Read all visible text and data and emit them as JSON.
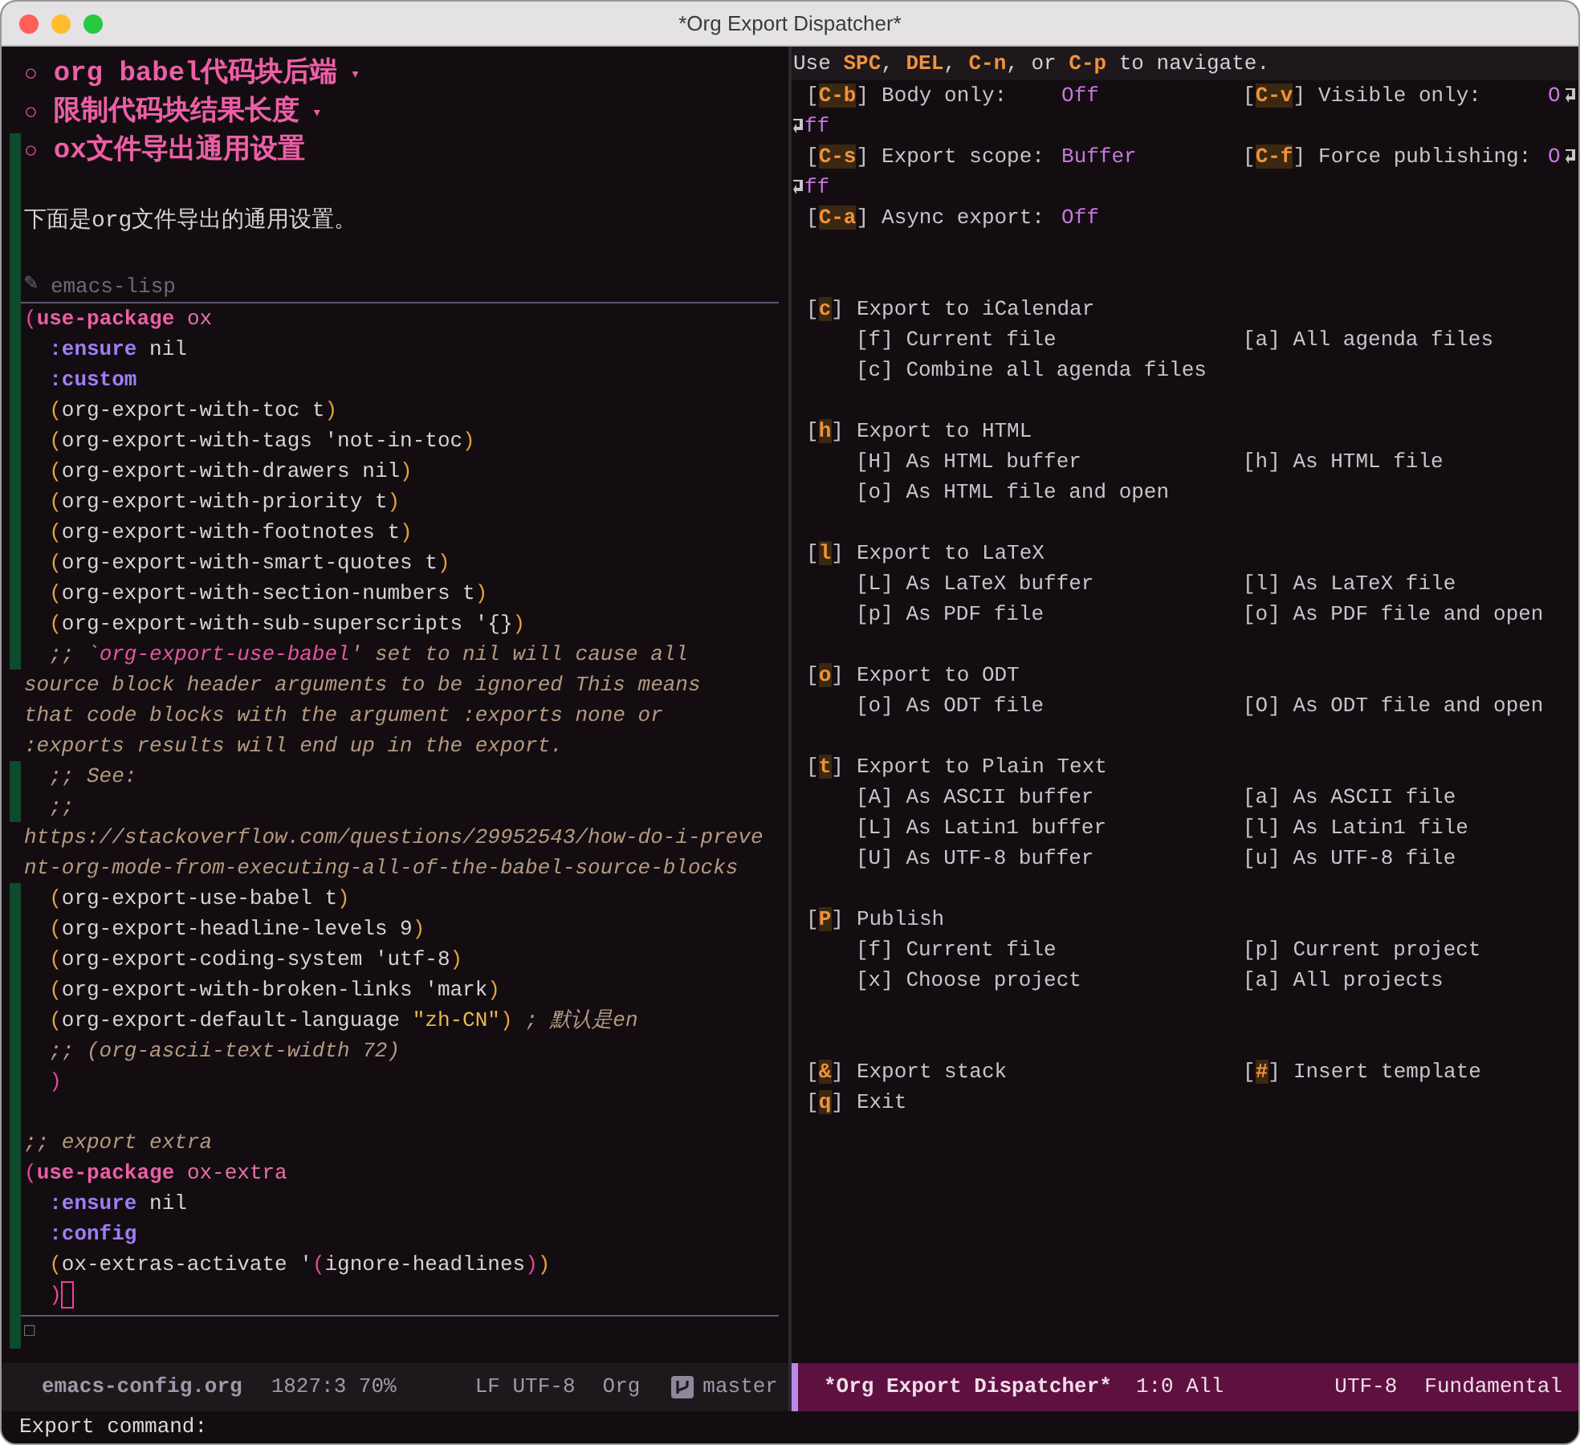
{
  "window": {
    "title": "*Org Export Dispatcher*"
  },
  "editor": {
    "lines": [
      {
        "kind": "heading",
        "bullet": "○",
        "text": "org babel代码块后端",
        "marker": "▾",
        "git_added": false
      },
      {
        "kind": "heading",
        "bullet": "○",
        "text": "限制代码块结果长度",
        "marker": "▾",
        "git_added": false
      },
      {
        "kind": "heading",
        "bullet": "○",
        "text": "ox文件导出通用设置",
        "git_added": true
      },
      {
        "kind": "blank",
        "git_added": true
      },
      {
        "kind": "text",
        "text": "下面是org文件导出的通用设置。",
        "git_added": true
      },
      {
        "kind": "blank",
        "git_added": true
      },
      {
        "kind": "src_header",
        "icon": "✎",
        "text": "emacs-lisp",
        "git_added": true
      },
      {
        "kind": "code",
        "git_added": true,
        "segments": [
          {
            "kind": "paren2",
            "text": "("
          },
          {
            "kind": "macro",
            "text": "use-package"
          },
          {
            "kind": "name",
            "text": " ox"
          }
        ]
      },
      {
        "kind": "code",
        "git_added": true,
        "segments": [
          {
            "kind": "keyword",
            "text": "  :ensure"
          },
          {
            "kind": "plain",
            "text": " nil"
          }
        ]
      },
      {
        "kind": "code",
        "git_added": true,
        "segments": [
          {
            "kind": "keyword",
            "text": "  :custom"
          }
        ]
      },
      {
        "kind": "code",
        "git_added": true,
        "segments": [
          {
            "kind": "paren",
            "text": "  ("
          },
          {
            "kind": "plain",
            "text": "org-export-with-toc t"
          },
          {
            "kind": "paren",
            "text": ")"
          }
        ]
      },
      {
        "kind": "code",
        "git_added": true,
        "segments": [
          {
            "kind": "paren",
            "text": "  ("
          },
          {
            "kind": "plain",
            "text": "org-export-with-tags 'not-in-toc"
          },
          {
            "kind": "paren",
            "text": ")"
          }
        ]
      },
      {
        "kind": "code",
        "git_added": true,
        "segments": [
          {
            "kind": "paren",
            "text": "  ("
          },
          {
            "kind": "plain",
            "text": "org-export-with-drawers nil"
          },
          {
            "kind": "paren",
            "text": ")"
          }
        ]
      },
      {
        "kind": "code",
        "git_added": true,
        "segments": [
          {
            "kind": "paren",
            "text": "  ("
          },
          {
            "kind": "plain",
            "text": "org-export-with-priority t"
          },
          {
            "kind": "paren",
            "text": ")"
          }
        ]
      },
      {
        "kind": "code",
        "git_added": true,
        "segments": [
          {
            "kind": "paren",
            "text": "  ("
          },
          {
            "kind": "plain",
            "text": "org-export-with-footnotes t"
          },
          {
            "kind": "paren",
            "text": ")"
          }
        ]
      },
      {
        "kind": "code",
        "git_added": true,
        "segments": [
          {
            "kind": "paren",
            "text": "  ("
          },
          {
            "kind": "plain",
            "text": "org-export-with-smart-quotes t"
          },
          {
            "kind": "paren",
            "text": ")"
          }
        ]
      },
      {
        "kind": "code",
        "git_added": true,
        "segments": [
          {
            "kind": "paren",
            "text": "  ("
          },
          {
            "kind": "plain",
            "text": "org-export-with-section-numbers t"
          },
          {
            "kind": "paren",
            "text": ")"
          }
        ]
      },
      {
        "kind": "code",
        "git_added": true,
        "segments": [
          {
            "kind": "paren",
            "text": "  ("
          },
          {
            "kind": "plain",
            "text": "org-export-with-sub-superscripts '{}"
          },
          {
            "kind": "paren",
            "text": ")"
          }
        ]
      },
      {
        "kind": "code",
        "git_added": true,
        "segments": [
          {
            "kind": "comment",
            "text": "  ;; `"
          },
          {
            "kind": "doc_ref",
            "text": "org-export-use-babel"
          },
          {
            "kind": "comment",
            "text": "' set to nil will cause all"
          }
        ]
      },
      {
        "kind": "code",
        "git_added": false,
        "segments": [
          {
            "kind": "comment",
            "text": "source block header arguments to be ignored This means"
          }
        ]
      },
      {
        "kind": "code",
        "git_added": false,
        "segments": [
          {
            "kind": "comment",
            "text": "that code blocks with the argument :exports none or"
          }
        ]
      },
      {
        "kind": "code",
        "git_added": false,
        "segments": [
          {
            "kind": "comment",
            "text": ":exports results will end up in the export."
          }
        ]
      },
      {
        "kind": "code",
        "git_added": true,
        "segments": [
          {
            "kind": "comment",
            "text": "  ;; See:"
          }
        ]
      },
      {
        "kind": "code",
        "git_added": true,
        "segments": [
          {
            "kind": "comment",
            "text": "  ;;"
          }
        ]
      },
      {
        "kind": "code",
        "git_added": false,
        "segments": [
          {
            "kind": "comment",
            "text": "https://stackoverflow.com/questions/29952543/how-do-i-preve"
          }
        ]
      },
      {
        "kind": "code",
        "git_added": false,
        "segments": [
          {
            "kind": "comment",
            "text": "nt-org-mode-from-executing-all-of-the-babel-source-blocks"
          }
        ]
      },
      {
        "kind": "code",
        "git_added": true,
        "segments": [
          {
            "kind": "paren",
            "text": "  ("
          },
          {
            "kind": "plain",
            "text": "org-export-use-babel t"
          },
          {
            "kind": "paren",
            "text": ")"
          }
        ]
      },
      {
        "kind": "code",
        "git_added": true,
        "segments": [
          {
            "kind": "paren",
            "text": "  ("
          },
          {
            "kind": "plain",
            "text": "org-export-headline-levels 9"
          },
          {
            "kind": "paren",
            "text": ")"
          }
        ]
      },
      {
        "kind": "code",
        "git_added": true,
        "segments": [
          {
            "kind": "paren",
            "text": "  ("
          },
          {
            "kind": "plain",
            "text": "org-export-coding-system 'utf-8"
          },
          {
            "kind": "paren",
            "text": ")"
          }
        ]
      },
      {
        "kind": "code",
        "git_added": true,
        "segments": [
          {
            "kind": "paren",
            "text": "  ("
          },
          {
            "kind": "plain",
            "text": "org-export-with-broken-links 'mark"
          },
          {
            "kind": "paren",
            "text": ")"
          }
        ]
      },
      {
        "kind": "code",
        "git_added": true,
        "segments": [
          {
            "kind": "paren",
            "text": "  ("
          },
          {
            "kind": "plain",
            "text": "org-export-default-language "
          },
          {
            "kind": "string",
            "text": "\"zh-CN\""
          },
          {
            "kind": "paren",
            "text": ")"
          },
          {
            "kind": "comment",
            "text": " ; 默认是en"
          }
        ]
      },
      {
        "kind": "code",
        "git_added": true,
        "segments": [
          {
            "kind": "comment",
            "text": "  ;; (org-ascii-text-width 72)"
          }
        ]
      },
      {
        "kind": "code",
        "git_added": true,
        "segments": [
          {
            "kind": "paren2",
            "text": "  )"
          }
        ]
      },
      {
        "kind": "blank_code",
        "git_added": true
      },
      {
        "kind": "code",
        "git_added": true,
        "segments": [
          {
            "kind": "comment",
            "text": ";; export extra"
          }
        ]
      },
      {
        "kind": "code",
        "git_added": true,
        "segments": [
          {
            "kind": "paren2",
            "text": "("
          },
          {
            "kind": "macro",
            "text": "use-package"
          },
          {
            "kind": "name",
            "text": " ox-extra"
          }
        ]
      },
      {
        "kind": "code",
        "git_added": true,
        "segments": [
          {
            "kind": "keyword",
            "text": "  :ensure"
          },
          {
            "kind": "plain",
            "text": " nil"
          }
        ]
      },
      {
        "kind": "code",
        "git_added": true,
        "segments": [
          {
            "kind": "keyword",
            "text": "  :config"
          }
        ]
      },
      {
        "kind": "code",
        "git_added": true,
        "segments": [
          {
            "kind": "paren",
            "text": "  ("
          },
          {
            "kind": "plain",
            "text": "ox-extras-activate '"
          },
          {
            "kind": "paren2",
            "text": "("
          },
          {
            "kind": "plain",
            "text": "ignore-headlines"
          },
          {
            "kind": "paren2",
            "text": ")"
          },
          {
            "kind": "paren",
            "text": ")"
          }
        ]
      },
      {
        "kind": "code",
        "git_added": true,
        "cursor": true,
        "segments": [
          {
            "kind": "paren2",
            "text": "  )"
          }
        ]
      },
      {
        "kind": "src_end",
        "git_added": true
      },
      {
        "kind": "text_dim",
        "text": "□",
        "git_added": true
      }
    ]
  },
  "dispatcher": {
    "hint": "Use **SPC**, **DEL**, **C-n**, or **C-p** to navigate.",
    "lines": [
      {
        "kind": "options",
        "left": {
          "key": "[C-b]",
          "label": "Body only:",
          "value": "Off"
        },
        "right": {
          "key": "[C-v]",
          "label": "Visible only:",
          "value": "O",
          "wrapped": true
        }
      },
      {
        "kind": "wrap",
        "text": "ff"
      },
      {
        "kind": "options",
        "left": {
          "key": "[C-s]",
          "label": "Export scope:",
          "value": "Buffer"
        },
        "right": {
          "key": "[C-f]",
          "label": "Force publishing:",
          "value": "O",
          "wrapped": true
        }
      },
      {
        "kind": "wrap",
        "text": "ff"
      },
      {
        "kind": "options",
        "left": {
          "key": "[C-a]",
          "label": "Async export:",
          "value": "Off"
        }
      },
      {
        "kind": "blank"
      },
      {
        "kind": "blank"
      },
      {
        "kind": "section",
        "left": {
          "key": "[c]",
          "title": "Export to iCalendar"
        }
      },
      {
        "kind": "entries",
        "left": "[f] Current file",
        "right": "[a] All agenda files"
      },
      {
        "kind": "entries",
        "left": "[c] Combine all agenda files"
      },
      {
        "kind": "blank"
      },
      {
        "kind": "section",
        "left": {
          "key": "[h]",
          "title": "Export to HTML"
        }
      },
      {
        "kind": "entries",
        "left": "[H] As HTML buffer",
        "right": "[h] As HTML file"
      },
      {
        "kind": "entries",
        "left": "[o] As HTML file and open"
      },
      {
        "kind": "blank"
      },
      {
        "kind": "section",
        "left": {
          "key": "[l]",
          "title": "Export to LaTeX"
        }
      },
      {
        "kind": "entries",
        "left": "[L] As LaTeX buffer",
        "right": "[l] As LaTeX file"
      },
      {
        "kind": "entries",
        "left": "[p] As PDF file",
        "right": "[o] As PDF file and open"
      },
      {
        "kind": "blank"
      },
      {
        "kind": "section",
        "left": {
          "key": "[o]",
          "title": "Export to ODT"
        }
      },
      {
        "kind": "entries",
        "left": "[o] As ODT file",
        "right": "[O] As ODT file and open"
      },
      {
        "kind": "blank"
      },
      {
        "kind": "section",
        "left": {
          "key": "[t]",
          "title": "Export to Plain Text"
        }
      },
      {
        "kind": "entries",
        "left": "[A] As ASCII buffer",
        "right": "[a] As ASCII file"
      },
      {
        "kind": "entries",
        "left": "[L] As Latin1 buffer",
        "right": "[l] As Latin1 file"
      },
      {
        "kind": "entries",
        "left": "[U] As UTF-8 buffer",
        "right": "[u] As UTF-8 file"
      },
      {
        "kind": "blank"
      },
      {
        "kind": "section",
        "left": {
          "key": "[P]",
          "title": "Publish"
        }
      },
      {
        "kind": "entries",
        "left": "[f] Current file",
        "right": "[p] Current project"
      },
      {
        "kind": "entries",
        "left": "[x] Choose project",
        "right": "[a] All projects"
      },
      {
        "kind": "blank"
      },
      {
        "kind": "blank"
      },
      {
        "kind": "section",
        "left": {
          "key": "[&]",
          "title": "Export stack"
        },
        "right": {
          "key": "[#]",
          "title": "Insert template"
        }
      },
      {
        "kind": "section",
        "left": {
          "key": "[q]",
          "title": "Exit"
        }
      }
    ]
  },
  "mode_lines": [
    {
      "active": false,
      "buffer": "emacs-config.org",
      "position": "1827:3 70%",
      "encoding": "LF UTF-8",
      "mode": "Org",
      "branch": "master"
    },
    {
      "active": true,
      "buffer": "*Org Export Dispatcher*",
      "position": "1:0 All",
      "encoding": "UTF-8",
      "mode": "Fundamental"
    }
  ],
  "minibuffer": {
    "prompt": "Export command:"
  }
}
